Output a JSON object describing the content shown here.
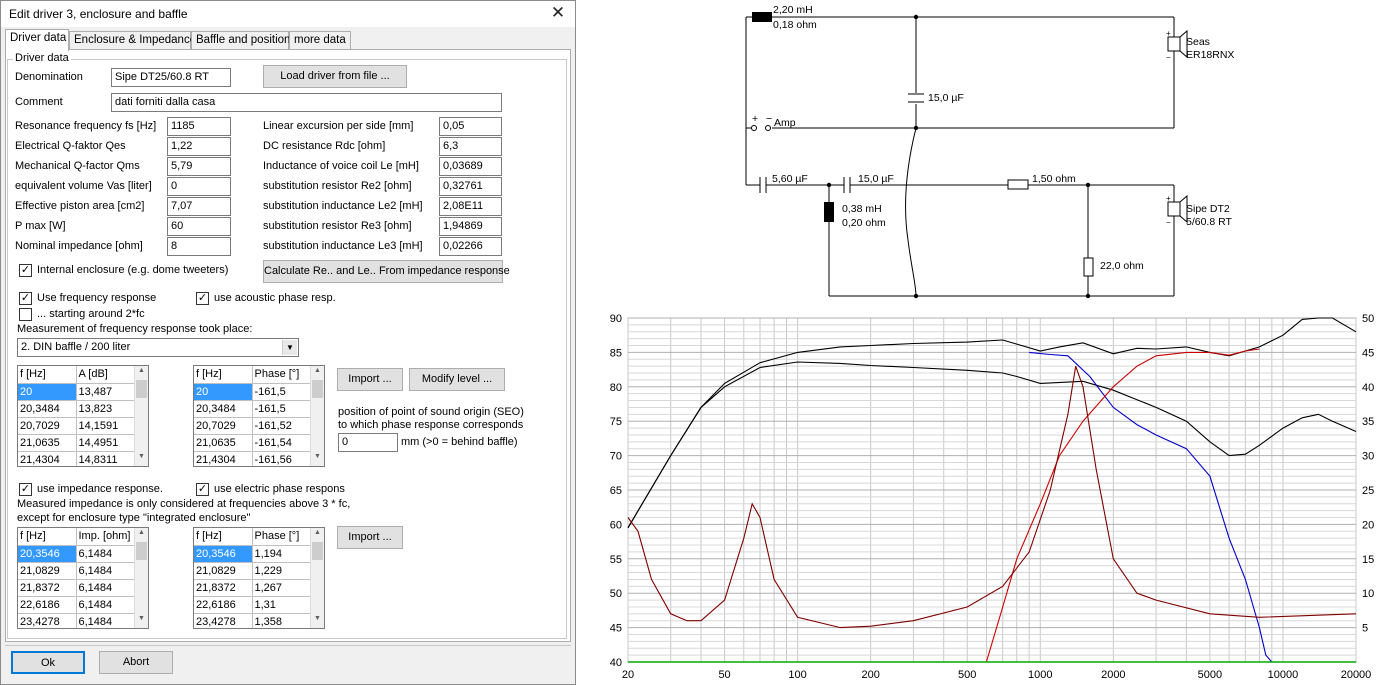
{
  "window": {
    "title": "Edit driver 3, enclosure and baffle",
    "close": "✕"
  },
  "tabs": [
    {
      "label": "Driver data",
      "active": true
    },
    {
      "label": "Enclosure & Impedance",
      "active": false
    },
    {
      "label": "Baffle and position",
      "active": false
    },
    {
      "label": "more data",
      "active": false
    }
  ],
  "group_label": "Driver data",
  "denomination": {
    "label": "Denomination",
    "value": "Sipe DT25/60.8 RT"
  },
  "load_button": "Load driver from file ...",
  "comment": {
    "label": "Comment",
    "value": "dati forniti dalla casa"
  },
  "params_left": [
    {
      "label": "Resonance frequency fs [Hz]",
      "value": "1185"
    },
    {
      "label": "Electrical Q-faktor Qes",
      "value": "1,22"
    },
    {
      "label": "Mechanical Q-factor Qms",
      "value": "5,79"
    },
    {
      "label": "equivalent volume Vas [liter]",
      "value": "0"
    },
    {
      "label": "Effective piston area [cm2]",
      "value": "7,07"
    },
    {
      "label": "P max [W]",
      "value": "60"
    },
    {
      "label": "Nominal impedance [ohm]",
      "value": "8"
    }
  ],
  "params_right": [
    {
      "label": "Linear excursion per side [mm]",
      "value": "0,05"
    },
    {
      "label": "DC resistance Rdc [ohm]",
      "value": "6,3"
    },
    {
      "label": "Inductance of voice coil Le [mH]",
      "value": "0,03689"
    },
    {
      "label": "substitution resistor Re2 [ohm]",
      "value": "0,32761"
    },
    {
      "label": "substitution inductance Le2 [mH]",
      "value": "2,08E11"
    },
    {
      "label": "substitution resistor Re3 [ohm]",
      "value": "1,94869"
    },
    {
      "label": "substitution inductance Le3 [mH]",
      "value": "0,02266"
    }
  ],
  "internal_enclosure": {
    "label": "Internal enclosure (e.g. dome tweeters)",
    "checked": true
  },
  "calc_button": "Calculate Re.. and Le.. From impedance response",
  "use_freq_resp": {
    "label": "Use frequency response",
    "checked": true
  },
  "use_acoustic_phase": {
    "label": "use acoustic phase resp.",
    "checked": true
  },
  "starting_around": {
    "label": "... starting around 2*fc",
    "checked": false
  },
  "measurement_label": "Measurement of frequency response took place:",
  "measurement_select": "2. DIN baffle / 200 liter",
  "freq_table": {
    "headers": [
      "f [Hz]",
      "A [dB]"
    ],
    "rows": [
      [
        "20",
        "13,487"
      ],
      [
        "20,3484",
        "13,823"
      ],
      [
        "20,7029",
        "14,1591"
      ],
      [
        "21,0635",
        "14,4951"
      ],
      [
        "21,4304",
        "14,8311"
      ]
    ]
  },
  "phase_table": {
    "headers": [
      "f [Hz]",
      "Phase [°]"
    ],
    "rows": [
      [
        "20",
        "-161,5"
      ],
      [
        "20,3484",
        "-161,5"
      ],
      [
        "20,7029",
        "-161,52"
      ],
      [
        "21,0635",
        "-161,54"
      ],
      [
        "21,4304",
        "-161,56"
      ]
    ]
  },
  "import_button_1": "Import ...",
  "modify_level_button": "Modify level ...",
  "seo_text_1": "position of point of sound origin (SEO)",
  "seo_text_2": "to which phase response corresponds",
  "seo_value": "0",
  "seo_unit": "mm (>0 = behind baffle)",
  "use_impedance": {
    "label": "use impedance response.",
    "checked": true
  },
  "use_electric_phase": {
    "label": "use electric phase respons",
    "checked": true
  },
  "imp_note_1": "Measured impedance is only considered at frequencies above 3 * fc,",
  "imp_note_2": "except for enclosure type \"integrated enclosure\"",
  "imp_table": {
    "headers": [
      "f [Hz]",
      "Imp. [ohm]"
    ],
    "rows": [
      [
        "20,3546",
        "6,1484"
      ],
      [
        "21,0829",
        "6,1484"
      ],
      [
        "21,8372",
        "6,1484"
      ],
      [
        "22,6186",
        "6,1484"
      ],
      [
        "23,4278",
        "6,1484"
      ]
    ]
  },
  "imp_phase_table": {
    "headers": [
      "f [Hz]",
      "Phase [°]"
    ],
    "rows": [
      [
        "20,3546",
        "1,194"
      ],
      [
        "21,0829",
        "1,229"
      ],
      [
        "21,8372",
        "1,267"
      ],
      [
        "22,6186",
        "1,31"
      ],
      [
        "23,4278",
        "1,358"
      ]
    ]
  },
  "import_button_2": "Import ...",
  "ok_button": "Ok",
  "abort_button": "Abort",
  "schematic": {
    "L1": "2,20 mH",
    "L1r": "0,18 ohm",
    "C1": "15,0 µF",
    "amp": "Amp",
    "plus": "+",
    "minus": "−",
    "drv1_name": "Seas",
    "drv1_model": "ER18RNX",
    "C2": "5,60 µF",
    "C3": "15,0 µF",
    "R1": "1,50 ohm",
    "L2": "0,38 mH",
    "L2r": "0,20 ohm",
    "R2": "22,0 ohm",
    "drv2_name": "Sipe DT2",
    "drv2_model": "5/60.8 RT"
  },
  "chart_data": {
    "type": "line",
    "x_scale": "log",
    "xlim": [
      20,
      20000
    ],
    "ylim_left": [
      40,
      90
    ],
    "ylim_right": [
      0,
      50
    ],
    "x_ticks": [
      "20",
      "50",
      "100",
      "200",
      "500",
      "1000",
      "2000",
      "5000",
      "10000",
      "20000"
    ],
    "y_ticks_left": [
      "40",
      "45",
      "50",
      "55",
      "60",
      "65",
      "70",
      "75",
      "80",
      "85",
      "90"
    ],
    "y_ticks_right": [
      "5",
      "10",
      "15",
      "20",
      "25",
      "30",
      "35",
      "40",
      "45",
      "50"
    ],
    "grid": true,
    "series": [
      {
        "color": "#000000",
        "points": [
          [
            20,
            59.5
          ],
          [
            30,
            70
          ],
          [
            40,
            77
          ],
          [
            50,
            80.5
          ],
          [
            70,
            83.5
          ],
          [
            100,
            85
          ],
          [
            150,
            85.8
          ],
          [
            200,
            86
          ],
          [
            300,
            86.3
          ],
          [
            500,
            86.5
          ],
          [
            700,
            86.8
          ],
          [
            800,
            86.2
          ],
          [
            1000,
            85.2
          ],
          [
            1200,
            85.8
          ],
          [
            1500,
            86.4
          ],
          [
            2000,
            84.8
          ],
          [
            2500,
            85.6
          ],
          [
            3000,
            85.5
          ],
          [
            4000,
            85.8
          ],
          [
            5000,
            85
          ],
          [
            6000,
            84.5
          ],
          [
            7000,
            85.2
          ],
          [
            8000,
            85.8
          ],
          [
            10000,
            87.5
          ],
          [
            12000,
            89.8
          ],
          [
            14000,
            90.5
          ],
          [
            16000,
            90
          ],
          [
            20000,
            88
          ]
        ]
      },
      {
        "color": "#000000",
        "points": [
          [
            20,
            59.5
          ],
          [
            30,
            70
          ],
          [
            40,
            77
          ],
          [
            50,
            80
          ],
          [
            70,
            82.8
          ],
          [
            100,
            83.6
          ],
          [
            150,
            83.4
          ],
          [
            200,
            83.1
          ],
          [
            300,
            82.8
          ],
          [
            500,
            82.4
          ],
          [
            700,
            82
          ],
          [
            800,
            81.5
          ],
          [
            1000,
            80.5
          ],
          [
            1500,
            80.8
          ],
          [
            2000,
            79.5
          ],
          [
            3000,
            77
          ],
          [
            4000,
            75
          ],
          [
            5000,
            72
          ],
          [
            6000,
            70
          ],
          [
            7000,
            70.2
          ],
          [
            8000,
            71.5
          ],
          [
            10000,
            74
          ],
          [
            12000,
            75.5
          ],
          [
            14000,
            76
          ],
          [
            16000,
            75
          ],
          [
            20000,
            73.5
          ]
        ]
      },
      {
        "color": "#0000cc",
        "points": [
          [
            900,
            85
          ],
          [
            1100,
            84.7
          ],
          [
            1300,
            84.5
          ],
          [
            1600,
            81.5
          ],
          [
            2000,
            77
          ],
          [
            2500,
            74.5
          ],
          [
            3000,
            73
          ],
          [
            4000,
            71
          ],
          [
            5000,
            67
          ],
          [
            6000,
            58
          ],
          [
            7000,
            52
          ],
          [
            8000,
            45
          ],
          [
            8500,
            41
          ],
          [
            9000,
            40
          ]
        ]
      },
      {
        "color": "#cc0000",
        "points": [
          [
            600,
            40
          ],
          [
            700,
            48
          ],
          [
            800,
            55
          ],
          [
            1000,
            63
          ],
          [
            1200,
            70
          ],
          [
            1500,
            75
          ],
          [
            2000,
            80
          ],
          [
            2500,
            83
          ],
          [
            3000,
            84.5
          ],
          [
            4000,
            85
          ],
          [
            5000,
            85
          ],
          [
            6000,
            84.6
          ],
          [
            7000,
            85.2
          ],
          [
            8000,
            85.5
          ]
        ]
      },
      {
        "color": "#800000",
        "points": [
          [
            20,
            21
          ],
          [
            22,
            19
          ],
          [
            25,
            12
          ],
          [
            30,
            7
          ],
          [
            35,
            6
          ],
          [
            40,
            6
          ],
          [
            50,
            9
          ],
          [
            60,
            18
          ],
          [
            65,
            23
          ],
          [
            70,
            21
          ],
          [
            80,
            12
          ],
          [
            100,
            6.5
          ],
          [
            150,
            5
          ],
          [
            200,
            5.2
          ],
          [
            300,
            6
          ],
          [
            500,
            8
          ],
          [
            700,
            11
          ],
          [
            900,
            16
          ],
          [
            1100,
            25
          ],
          [
            1300,
            36
          ],
          [
            1400,
            43
          ],
          [
            1500,
            40
          ],
          [
            1700,
            28
          ],
          [
            2000,
            15
          ],
          [
            2500,
            10
          ],
          [
            3000,
            9
          ],
          [
            5000,
            7
          ],
          [
            8000,
            6.5
          ],
          [
            20000,
            7
          ]
        ]
      },
      {
        "color": "#00aa00",
        "points": [
          [
            20,
            0
          ],
          [
            20000,
            0
          ]
        ]
      }
    ]
  }
}
